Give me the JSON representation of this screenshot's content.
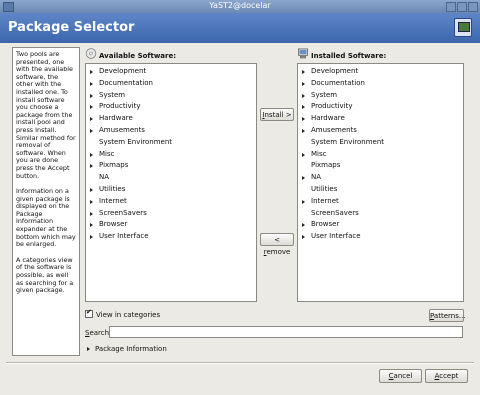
{
  "window": {
    "title": "YaST2@docelar"
  },
  "header": {
    "title": "Package Selector",
    "icon": "yast-package-icon"
  },
  "help": {
    "paragraphs": [
      "Two pools are presented, one with the available software, the other with the installed one. To install software you choose a package from the install pool and press Install. Similar method for removal of software. When you are done press the Accept button.",
      "Information on a given package is displayed on the Package Information expander at the bottom which may be enlarged.",
      "A categories view of the software is possible, as well as searching for a given package."
    ]
  },
  "available": {
    "label": "Available Software:",
    "items": [
      {
        "label": "Development",
        "expandable": true
      },
      {
        "label": "Documentation",
        "expandable": true
      },
      {
        "label": "System",
        "expandable": true
      },
      {
        "label": "Productivity",
        "expandable": true
      },
      {
        "label": "Hardware",
        "expandable": true
      },
      {
        "label": "Amusements",
        "expandable": true
      },
      {
        "label": "System Environment",
        "expandable": false
      },
      {
        "label": "Misc",
        "expandable": true
      },
      {
        "label": "Pixmaps",
        "expandable": true
      },
      {
        "label": "NA",
        "expandable": false
      },
      {
        "label": "Utilities",
        "expandable": true
      },
      {
        "label": "Internet",
        "expandable": true
      },
      {
        "label": "ScreenSavers",
        "expandable": true
      },
      {
        "label": "Browser",
        "expandable": true
      },
      {
        "label": "User Interface",
        "expandable": true
      }
    ]
  },
  "installed": {
    "label": "Installed Software:",
    "items": [
      {
        "label": "Development",
        "expandable": true
      },
      {
        "label": "Documentation",
        "expandable": true
      },
      {
        "label": "System",
        "expandable": true
      },
      {
        "label": "Productivity",
        "expandable": true
      },
      {
        "label": "Hardware",
        "expandable": true
      },
      {
        "label": "Amusements",
        "expandable": true
      },
      {
        "label": "System Environment",
        "expandable": false
      },
      {
        "label": "Misc",
        "expandable": true
      },
      {
        "label": "Pixmaps",
        "expandable": false
      },
      {
        "label": "NA",
        "expandable": true
      },
      {
        "label": "Utilities",
        "expandable": false
      },
      {
        "label": "Internet",
        "expandable": true
      },
      {
        "label": "ScreenSavers",
        "expandable": false
      },
      {
        "label": "Browser",
        "expandable": true
      },
      {
        "label": "User Interface",
        "expandable": true
      }
    ]
  },
  "buttons": {
    "install": {
      "pre": "",
      "key": "I",
      "post": "nstall >"
    },
    "remove": {
      "pre": "< ",
      "key": "r",
      "post": "emove"
    },
    "patterns": {
      "pre": "",
      "key": "P",
      "post": "atterns..."
    },
    "cancel": {
      "pre": "",
      "key": "C",
      "post": "ancel"
    },
    "accept": {
      "pre": "",
      "key": "A",
      "post": "ccept"
    }
  },
  "view_categories": {
    "label": "View in categories",
    "checked": true
  },
  "search": {
    "label_key": "S",
    "label_rest": "earch:",
    "value": ""
  },
  "package_info": {
    "label": "Package Information"
  }
}
